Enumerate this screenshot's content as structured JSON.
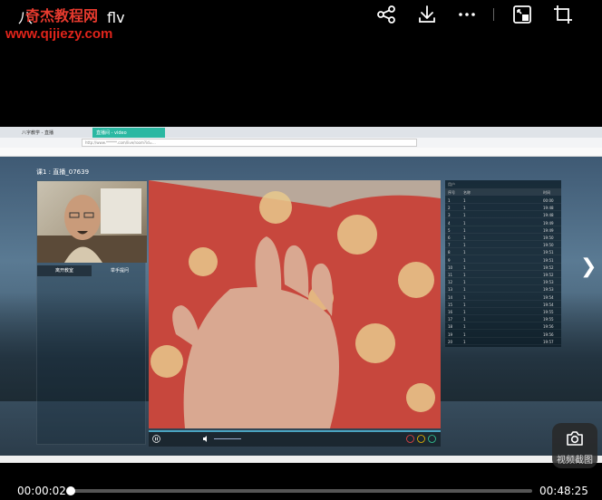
{
  "player": {
    "title": "八",
    "title_suffix": "flv",
    "watermark_cn": "奇杰教程网",
    "watermark_url": "www.qijiezy.com",
    "toolbar_icons": [
      "share-icon",
      "download-icon",
      "more-icon",
      "picture-in-picture-icon",
      "crop-icon"
    ],
    "current_time": "00:00:02",
    "total_time": "00:48:25",
    "progress": 0.0007,
    "next_arrow": "❯",
    "screenshot_label": "视频截图"
  },
  "browser": {
    "tabs": [
      "八字教学 - 直播",
      "直播间 - video"
    ],
    "url": "http://www.******.com/live/room?id=...",
    "room_label": "课1 : 直播_07639",
    "cam_buttons": [
      "离开教室",
      "举手提问"
    ],
    "panel_header": "用户",
    "panel_cols": [
      "序号",
      "名称",
      "时间"
    ],
    "panel_rows": [
      [
        "1",
        "1",
        "00:00"
      ],
      [
        "2",
        "1",
        "19:48"
      ],
      [
        "3",
        "1",
        "19:48"
      ],
      [
        "4",
        "1",
        "19:49"
      ],
      [
        "5",
        "1",
        "19:49"
      ],
      [
        "6",
        "1",
        "19:50"
      ],
      [
        "7",
        "1",
        "19:50"
      ],
      [
        "8",
        "1",
        "19:51"
      ],
      [
        "9",
        "1",
        "19:51"
      ],
      [
        "10",
        "1",
        "19:52"
      ],
      [
        "11",
        "1",
        "19:52"
      ],
      [
        "12",
        "1",
        "19:53"
      ],
      [
        "13",
        "1",
        "19:53"
      ],
      [
        "14",
        "1",
        "19:54"
      ],
      [
        "15",
        "1",
        "19:54"
      ],
      [
        "16",
        "1",
        "19:55"
      ],
      [
        "17",
        "1",
        "19:55"
      ],
      [
        "18",
        "1",
        "19:56"
      ],
      [
        "19",
        "1",
        "19:56"
      ],
      [
        "20",
        "1",
        "19:57"
      ]
    ]
  },
  "colors": {
    "watermark": "#e0241b",
    "accent": "#2bb8a2"
  }
}
